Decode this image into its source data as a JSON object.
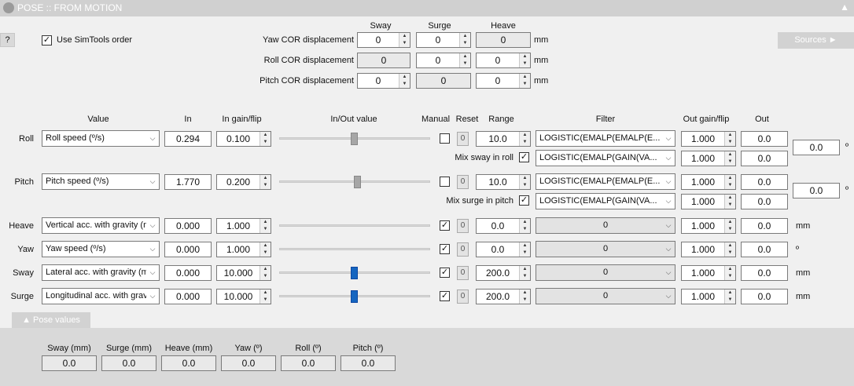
{
  "window": {
    "title": "POSE :: FROM MOTION",
    "collapse_glyph": "▲"
  },
  "help_label": "?",
  "simtools": {
    "label": "Use SimTools order",
    "checked": true
  },
  "cor": {
    "headers": {
      "sway": "Sway",
      "surge": "Surge",
      "heave": "Heave"
    },
    "unit": "mm",
    "rows": [
      {
        "label": "Yaw COR displacement",
        "sway": "0",
        "surge": "0",
        "heave": "0"
      },
      {
        "label": "Roll COR displacement",
        "sway": "0",
        "surge": "0",
        "heave": "0"
      },
      {
        "label": "Pitch COR displacement",
        "sway": "0",
        "surge": "0",
        "heave": "0"
      }
    ]
  },
  "sources_label": "Sources ►",
  "headers": {
    "value": "Value",
    "in": "In",
    "in_gain": "In gain/flip",
    "inout": "In/Out value",
    "manual": "Manual",
    "reset": "Reset",
    "range": "Range",
    "filter": "Filter",
    "out_gain": "Out gain/flip",
    "out": "Out"
  },
  "axes": [
    {
      "label": "Roll",
      "value": "Roll speed (º/s)",
      "in": "0.294",
      "gain": "0.100",
      "slider": 0.5,
      "manual": false,
      "reset": "0",
      "range": "10.0",
      "filter": "LOGISTIC(EMALP(EMALP(E...",
      "filter_disabled": false,
      "out_gain": "1.000",
      "out": "0.0",
      "mix": {
        "label": "Mix sway in roll",
        "checked": true,
        "filter": "LOGISTIC(EMALP(GAIN(VA...",
        "out_gain": "1.000",
        "out": "0.0"
      },
      "total": "0.0",
      "unit": "º"
    },
    {
      "label": "Pitch",
      "value": "Pitch speed (º/s)",
      "in": "1.770",
      "gain": "0.200",
      "slider": 0.52,
      "manual": false,
      "reset": "0",
      "range": "10.0",
      "filter": "LOGISTIC(EMALP(EMALP(E...",
      "filter_disabled": false,
      "out_gain": "1.000",
      "out": "0.0",
      "mix": {
        "label": "Mix surge in pitch",
        "checked": true,
        "filter": "LOGISTIC(EMALP(GAIN(VA...",
        "out_gain": "1.000",
        "out": "0.0"
      },
      "total": "0.0",
      "unit": "º"
    },
    {
      "label": "Heave",
      "value": "Vertical acc. with gravity (m",
      "in": "0.000",
      "gain": "1.000",
      "slider": null,
      "manual": true,
      "reset": "0",
      "range": "0.0",
      "filter": "0",
      "filter_disabled": true,
      "out_gain": "1.000",
      "out": "0.0",
      "unit": "mm"
    },
    {
      "label": "Yaw",
      "value": "Yaw speed (º/s)",
      "in": "0.000",
      "gain": "1.000",
      "slider": null,
      "manual": true,
      "reset": "0",
      "range": "0.0",
      "filter": "0",
      "filter_disabled": true,
      "out_gain": "1.000",
      "out": "0.0",
      "unit": "º"
    },
    {
      "label": "Sway",
      "value": "Lateral acc. with gravity (m",
      "in": "0.000",
      "gain": "10.000",
      "slider": 0.5,
      "manual": true,
      "reset": "0",
      "range": "200.0",
      "filter": "0",
      "filter_disabled": true,
      "out_gain": "1.000",
      "out": "0.0",
      "unit": "mm"
    },
    {
      "label": "Surge",
      "value": "Longitudinal acc. with grav",
      "in": "0.000",
      "gain": "10.000",
      "slider": 0.5,
      "manual": true,
      "reset": "0",
      "range": "200.0",
      "filter": "0",
      "filter_disabled": true,
      "out_gain": "1.000",
      "out": "0.0",
      "unit": "mm"
    }
  ],
  "pose_tab_label": "▲   Pose values",
  "pose_values": [
    {
      "label": "Sway (mm)",
      "value": "0.0"
    },
    {
      "label": "Surge (mm)",
      "value": "0.0"
    },
    {
      "label": "Heave (mm)",
      "value": "0.0"
    },
    {
      "label": "Yaw (º)",
      "value": "0.0"
    },
    {
      "label": "Roll (º)",
      "value": "0.0"
    },
    {
      "label": "Pitch (º)",
      "value": "0.0"
    }
  ]
}
